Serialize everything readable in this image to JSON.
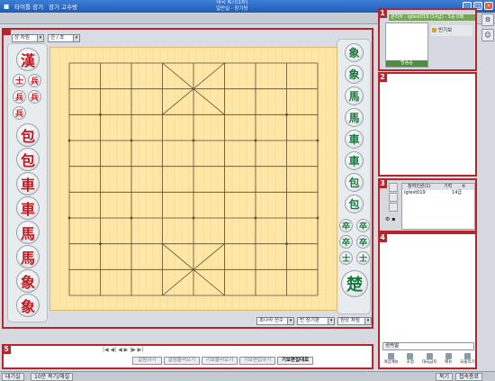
{
  "titlebar": {
    "left_items": [
      "타이틀 장기",
      "장기 고수방"
    ],
    "center_line1": "대국 복기(1차)",
    "center_line2": "일반실 · 장기방",
    "icons": [
      "minimize-icon",
      "maximize-icon",
      "close-icon"
    ]
  },
  "sections": {
    "s1": "1",
    "s2": "2",
    "s3": "3",
    "s4": "4",
    "s5": "5"
  },
  "board_controls": {
    "top_left_select": "상 차림",
    "top_mid_select": "한 / 초",
    "bottom_select_1": "초나라 선수",
    "bottom_select_2": "빈 장기판",
    "bottom_select_3": "원상 차림"
  },
  "left_tray": {
    "big": [
      "漢"
    ],
    "small_pairs": [
      [
        "士",
        "兵"
      ],
      [
        "兵",
        "兵"
      ],
      [
        "兵"
      ]
    ],
    "large": [
      "包",
      "包",
      "車",
      "車",
      "馬",
      "馬",
      "象",
      "象"
    ]
  },
  "right_tray": {
    "large": [
      "象",
      "象",
      "馬",
      "馬",
      "車",
      "車",
      "包",
      "包"
    ],
    "small": [
      "卒",
      "卒",
      "卒",
      "卒",
      "士",
      "士"
    ],
    "king": "楚"
  },
  "board": {
    "cols": 9,
    "rows": 10,
    "line_color": "#5b4a2c",
    "bg_color": "#fde6a6"
  },
  "panel1": {
    "header": "관리자 : igtest019 (14급) - 5승 0패",
    "item": "빈기보",
    "footer": "방송중"
  },
  "panel3": {
    "col_name": "참여인원(1)",
    "col_rank": "기력",
    "col_extra": "※",
    "row_name": "igtest019",
    "row_rank": "14급"
  },
  "panel4": {
    "chat_label": "귓속말",
    "buttons": [
      "게임메뉴",
      "초청",
      "대국금지",
      "메뉴",
      "되돌리기"
    ]
  },
  "panel5": {
    "nav": "|◀  ◀|  ◀  ▶  |▶  ▶|",
    "buttons": [
      "갈림하기",
      "갈림불러오기",
      "기보불러오기",
      "기보편집하기",
      "기보편집대로"
    ]
  },
  "right_side_buttons": [
    "settings-icon",
    "user-icon"
  ],
  "taskbar": {
    "tabs": [
      "대기실",
      "10분 복기/해설"
    ],
    "right": [
      "복기",
      "접속종료"
    ]
  },
  "colors": {
    "accent_red": "#b5262c",
    "piece_red": "#c2191f",
    "piece_green": "#157a3a"
  }
}
